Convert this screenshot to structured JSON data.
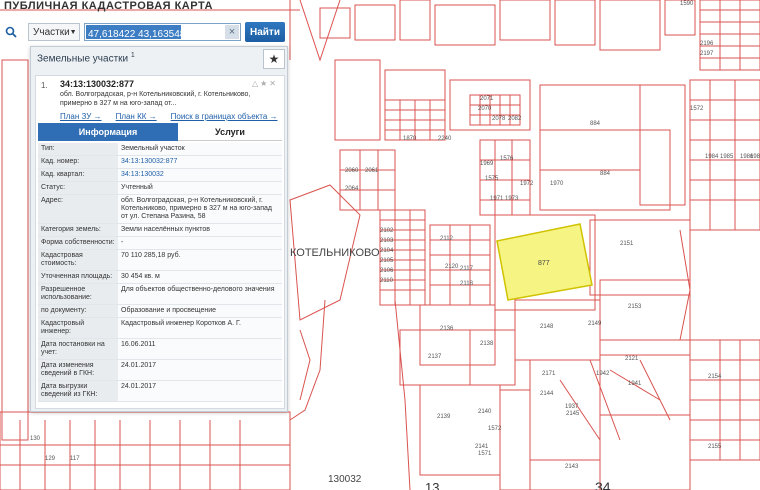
{
  "app": {
    "title": "ПУБЛИЧНАЯ КАДАСТРОВАЯ КАРТА"
  },
  "toolbar": {
    "search_type": "Участки",
    "search_value": "47,618422 43,163548",
    "search_button": "Найти",
    "clear": "×"
  },
  "panel": {
    "title": "Земельные участки",
    "count": "1",
    "item_number": "1.",
    "cadastral_number": "34:13:130032:877",
    "address_short": "обл. Волгоградская, р-н Котельниковский, г. Котельниково, примерно в 327 м на юго-запад от...",
    "links": [
      "План ЗУ →",
      "План КК →",
      "Поиск в границах объекта →"
    ],
    "tabs": [
      "Информация",
      "Услуги"
    ],
    "rows": [
      {
        "k": "Тип:",
        "v": "Земельный участок",
        "link": false
      },
      {
        "k": "Кад. номер:",
        "v": "34:13:130032:877",
        "link": true
      },
      {
        "k": "Кад. квартал:",
        "v": "34:13:130032",
        "link": true
      },
      {
        "k": "Статус:",
        "v": "Учтенный",
        "link": false
      },
      {
        "k": "Адрес:",
        "v": "обл. Волгоградская, р-н Котельниковский, г. Котельниково, примерно в 327 м на юго-запад от ул. Степана Разина, 58",
        "link": false
      },
      {
        "k": "Категория земель:",
        "v": "Земли населённых пунктов",
        "link": false
      },
      {
        "k": "Форма собственности:",
        "v": "-",
        "link": false
      },
      {
        "k": "Кадастровая стоимость:",
        "v": "70 110 285,18 руб.",
        "link": false
      },
      {
        "k": "Уточненная площадь:",
        "v": "30 454 кв. м",
        "link": false
      },
      {
        "k": "Разрешенное использование:",
        "v": "Для объектов общественно-делового значения",
        "link": false
      },
      {
        "k": "по документу:",
        "v": "Образование и просвещение",
        "link": false
      },
      {
        "k": "Кадастровый инженер:",
        "v": "Кадастровый инженер Коротков А. Г.",
        "link": false
      },
      {
        "k": "Дата постановки на учет:",
        "v": "16.06.2011",
        "link": false
      },
      {
        "k": "Дата изменения сведений в ГКН:",
        "v": "24.01.2017",
        "link": false
      },
      {
        "k": "Дата выгрузки сведений из ГКН:",
        "v": "24.01.2017",
        "link": false
      }
    ]
  },
  "map": {
    "town_label": "КОТЕЛЬНИКОВО",
    "highlight_label": "877",
    "quarter_label": "130032",
    "bottom_labels": [
      "13",
      "34"
    ],
    "parcel_labels": [
      "884",
      "884",
      "2151",
      "2153",
      "2148",
      "2136",
      "2137",
      "2138",
      "2139",
      "2140",
      "2141",
      "2143",
      "2144",
      "2145",
      "2149",
      "2154",
      "2155",
      "1572",
      "1590",
      "2197",
      "2196",
      "1984",
      "1985",
      "1986",
      "1987",
      "2070",
      "2078",
      "2082",
      "1870",
      "2240",
      "2071",
      "2102",
      "2103",
      "2104",
      "2105",
      "2106",
      "2110",
      "2112",
      "2117",
      "2120",
      "2118",
      "2121",
      "1941",
      "1942",
      "1937",
      "1572",
      "2060",
      "2061",
      "2064",
      "1970",
      "1972",
      "1973",
      "1971",
      "1969",
      "1575",
      "1576",
      "2171",
      "1571",
      "130",
      "129",
      "117"
    ],
    "colors": {
      "parcel_line": "#d9534f",
      "highlight_fill": "#f6f583",
      "highlight_stroke": "#d0c200"
    }
  }
}
